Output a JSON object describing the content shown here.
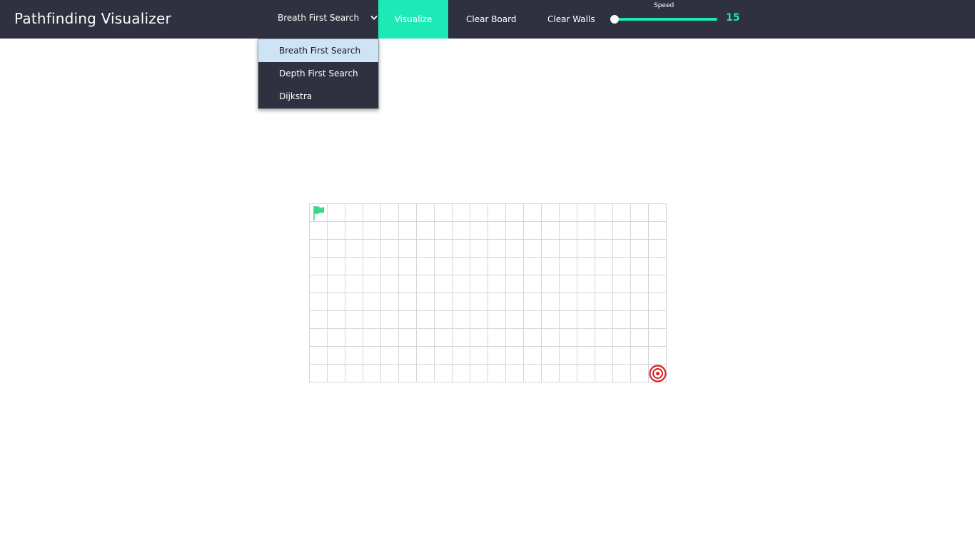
{
  "navbar": {
    "title": "Pathfinding Visualizer",
    "algorithm_selected": "Breath First Search",
    "visualize_label": "Visualize",
    "clear_board_label": "Clear Board",
    "clear_walls_label": "Clear Walls",
    "speed_label": "Speed",
    "speed_value": "15",
    "speed_fraction": 0.0
  },
  "dropdown": {
    "options": [
      {
        "label": "Breath First Search",
        "active": true
      },
      {
        "label": "Depth First Search",
        "active": false
      },
      {
        "label": "Dijkstra",
        "active": false
      }
    ]
  },
  "grid": {
    "rows": 10,
    "cols": 20,
    "start": {
      "row": 0,
      "col": 0,
      "icon": "flag-icon"
    },
    "target": {
      "row": 9,
      "col": 19,
      "icon": "target-icon"
    }
  },
  "colors": {
    "navbar_bg": "#2f3140",
    "accent": "#1de9b6",
    "start_flag": "#3dd68c",
    "target": "#d91e1e",
    "dropdown_active_bg": "#cfe3f7"
  }
}
